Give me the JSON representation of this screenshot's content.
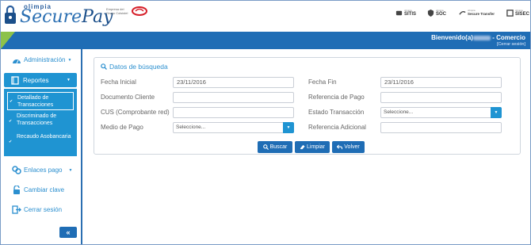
{
  "header": {
    "brand_top": "olimpia",
    "brand_main": "Secure",
    "brand_main2": "Pay",
    "group_text": "Empresa del Grupo Colsistel",
    "partners": [
      {
        "name": "SITIS",
        "small": "olimpia"
      },
      {
        "name": "SOC",
        "small": "olimpia"
      },
      {
        "name": "Secure Transfer",
        "small": "olimpia"
      },
      {
        "name": "SISEC",
        "small": "olimpia"
      }
    ]
  },
  "topbar": {
    "welcome_prefix": "Bienvenido(a)",
    "welcome_suffix": "- Comercio",
    "logout_link": "[Cerrar sesión]"
  },
  "sidebar": {
    "administracion": "Administración",
    "reportes": "Reportes",
    "sub_items": [
      "Detallado de Transacciones",
      "Discriminado de Transacciones",
      "Recaudo Asobancaria"
    ],
    "enlaces_pago": "Enlaces pago",
    "cambiar_clave": "Cambiar clave",
    "cerrar_sesion": "Cerrar sesión",
    "collapse": "«"
  },
  "panel": {
    "title": "Datos de búsqueda",
    "fecha_inicial_label": "Fecha Inicial",
    "fecha_inicial_value": "23/11/2016",
    "fecha_fin_label": "Fecha Fin",
    "fecha_fin_value": "23/11/2016",
    "documento_cliente_label": "Documento Cliente",
    "documento_cliente_value": "",
    "referencia_pago_label": "Referencia de Pago",
    "referencia_pago_value": "",
    "cus_label": "CUS (Comprobante red)",
    "cus_value": "",
    "estado_label": "Estado Transacción",
    "estado_value": "Seleccione...",
    "medio_pago_label": "Medio de Pago",
    "medio_pago_value": "Seleccione...",
    "referencia_adicional_label": "Referencia Adicional",
    "referencia_adicional_value": "",
    "buttons": {
      "buscar": "Buscar",
      "limpiar": "Limpiar",
      "volver": "Volver"
    }
  },
  "colors": {
    "primary": "#1f6db5",
    "accent": "#1f94d2",
    "green": "#8cc24a"
  }
}
